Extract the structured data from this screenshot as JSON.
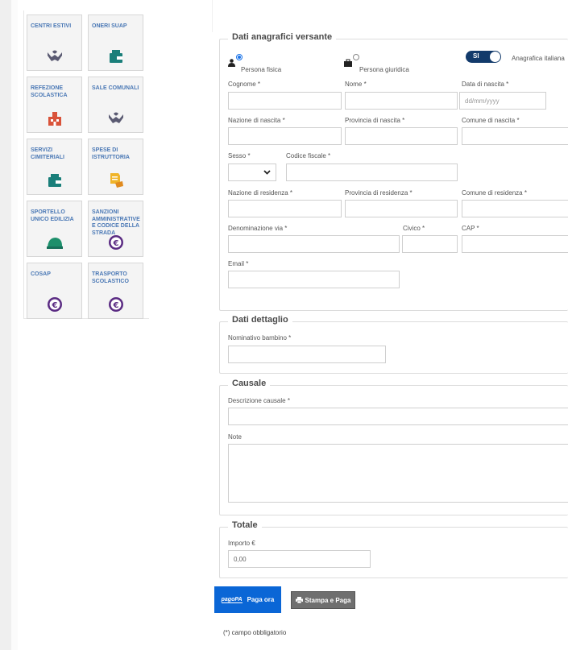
{
  "tiles": [
    {
      "label": "CENTRI ESTIVI",
      "icon": "hands-care-icon",
      "icon_color": "#5a5a72"
    },
    {
      "label": "ONERI SUAP",
      "icon": "wallet-icon",
      "icon_color": "#1a7f7a"
    },
    {
      "label": "REFEZIONE SCOLASTICA",
      "icon": "school-building-icon",
      "icon_color": "#d9533a"
    },
    {
      "label": "SALE COMUNALI",
      "icon": "hands-care-icon",
      "icon_color": "#5a5a72"
    },
    {
      "label": "SERVIZI CIMITERIALI",
      "icon": "wallet-icon",
      "icon_color": "#1a7f7a"
    },
    {
      "label": "SPESE DI ISTRUTTORIA",
      "icon": "document-hand-icon",
      "icon_color": "#f0b429"
    },
    {
      "label": "SPORTELLO UNICO EDILIZIA",
      "icon": "helmet-icon",
      "icon_color": "#1d8f6b"
    },
    {
      "label": "SANZIONI AMMINISTRATIVE E CODICE DELLA STRADA",
      "icon": "euro-coin-icon",
      "icon_color": "#5b2c83"
    },
    {
      "label": "COSAP",
      "icon": "euro-coin-icon",
      "icon_color": "#5b2c83"
    },
    {
      "label": "TRASPORTO SCOLASTICO",
      "icon": "euro-coin-icon",
      "icon_color": "#5b2c83"
    }
  ],
  "anagrafica": {
    "legend": "Dati anagrafici versante",
    "persona_fisica": "Persona fisica",
    "persona_giuridica": "Persona giuridica",
    "toggle_label": "SI",
    "toggle_caption": "Anagrafica italiana",
    "cognome": "Cognome *",
    "nome": "Nome *",
    "data_nascita": "Data di nascita *",
    "data_placeholder": "dd/mm/yyyy",
    "nazione_nascita": "Nazione di nascita *",
    "provincia_nascita": "Provincia di nascita *",
    "comune_nascita": "Comune di nascita *",
    "sesso": "Sesso *",
    "codice_fiscale": "Codice fiscale *",
    "nazione_residenza": "Nazione di residenza *",
    "provincia_residenza": "Provincia di residenza *",
    "comune_residenza": "Comune di residenza *",
    "denominazione_via": "Denominazione via *",
    "civico": "Civico *",
    "cap": "CAP *",
    "email": "Email *"
  },
  "dettaglio": {
    "legend": "Dati dettaglio",
    "nominativo": "Nominativo bambino  *"
  },
  "causale": {
    "legend": "Causale",
    "descrizione": "Descrizione causale *",
    "note": "Note"
  },
  "totale": {
    "legend": "Totale",
    "importo_label": "Importo €",
    "importo_value": "0,00"
  },
  "buttons": {
    "pagopa_logo": "pagoPA",
    "paga": "Paga ora",
    "stampa": "Stampa e Paga"
  },
  "footnote": "(*) campo obbligatorio"
}
